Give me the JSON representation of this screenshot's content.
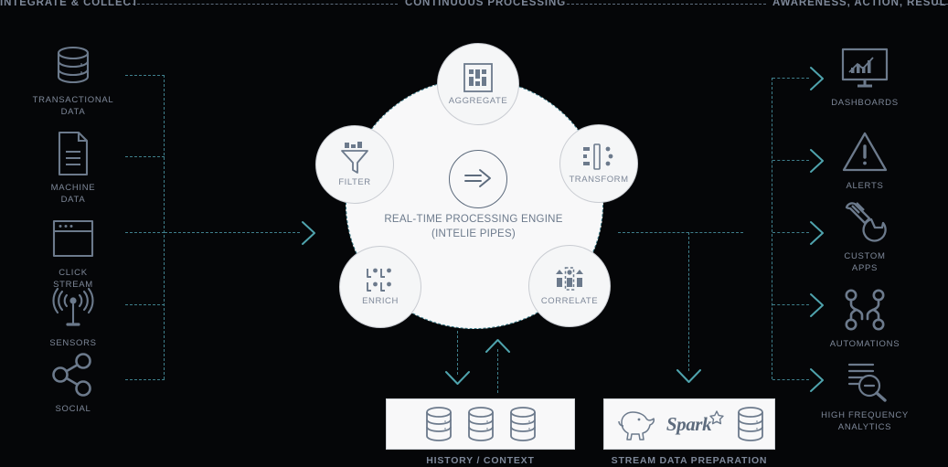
{
  "headers": {
    "left": "INTEGRATE & COLLECT",
    "middle": "CONTINUOUS PROCESSING",
    "right": "AWARENESS, ACTION, RESULTS"
  },
  "sources": [
    {
      "label": "TRANSACTIONAL\nDATA",
      "icon": "database-icon"
    },
    {
      "label": "MACHINE\nDATA",
      "icon": "document-icon"
    },
    {
      "label": "CLICK\nSTREAM",
      "icon": "browser-window-icon"
    },
    {
      "label": "SENSORS",
      "icon": "antenna-signal-icon"
    },
    {
      "label": "SOCIAL",
      "icon": "share-network-icon"
    }
  ],
  "engine": {
    "title_line1": "REAL-TIME PROCESSING ENGINE",
    "title_line2": "(INTELIE PIPES)",
    "core_icon": "arrow-pipe-icon",
    "stages": [
      {
        "label": "AGGREGATE",
        "icon": "aggregate-blocks-icon"
      },
      {
        "label": "FILTER",
        "icon": "funnel-icon"
      },
      {
        "label": "TRANSFORM",
        "icon": "transform-icon"
      },
      {
        "label": "ENRICH",
        "icon": "enrich-brackets-icon"
      },
      {
        "label": "CORRELATE",
        "icon": "correlate-icon"
      }
    ]
  },
  "outputs": [
    {
      "label": "DASHBOARDS",
      "icon": "monitor-chart-icon"
    },
    {
      "label": "ALERTS",
      "icon": "warning-triangle-icon"
    },
    {
      "label": "CUSTOM\nAPPS",
      "icon": "wrench-icon"
    },
    {
      "label": "AUTOMATIONS",
      "icon": "automation-nodes-icon"
    },
    {
      "label": "HIGH FREQUENCY\nANALYTICS",
      "icon": "magnifier-lines-icon"
    }
  ],
  "stores": [
    {
      "label": "HISTORY / CONTEXT",
      "items": [
        "database-icon",
        "database-icon",
        "database-icon"
      ]
    },
    {
      "label": "STREAM DATA PREPARATION",
      "items": [
        "hadoop-elephant-logo",
        "spark-logo",
        "database-icon"
      ],
      "spark_wordmark": "Spark"
    }
  ],
  "colors": {
    "background": "#050608",
    "icon_stroke": "#6c7a8c",
    "label_text": "#7e8899",
    "connector_dash": "#3f7f8c",
    "arrow": "#4fa3ad",
    "cloud_fill": "#f8f8f9",
    "pill_border": "#c9ccd2"
  }
}
